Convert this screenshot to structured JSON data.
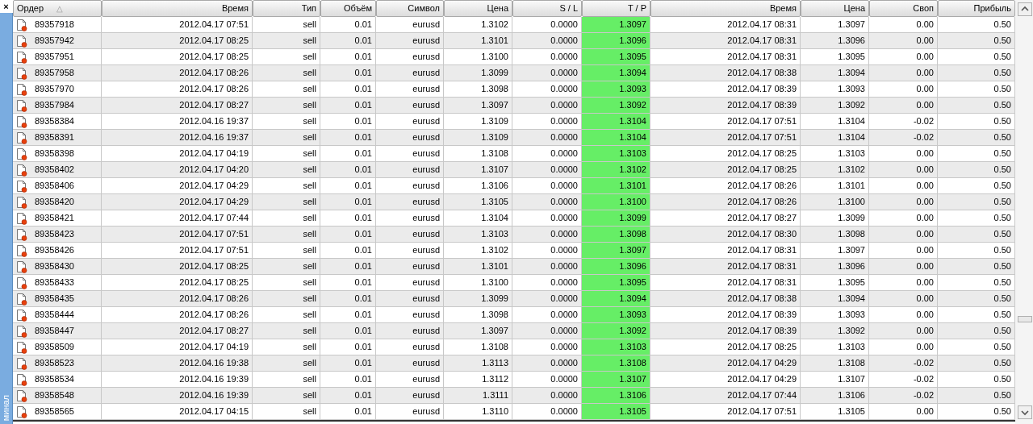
{
  "side_panel": {
    "close": "×",
    "label": "минал"
  },
  "table": {
    "columns": [
      {
        "label": "Ордер",
        "sort_indicator": "△",
        "highlight": false
      },
      {
        "label": "Время",
        "highlight": false
      },
      {
        "label": "Тип",
        "highlight": false
      },
      {
        "label": "Объём",
        "highlight": false
      },
      {
        "label": "Символ",
        "highlight": false
      },
      {
        "label": "Цена",
        "highlight": false
      },
      {
        "label": "S / L",
        "highlight": false
      },
      {
        "label": "T / P",
        "highlight": true
      },
      {
        "label": "Время",
        "highlight": false
      },
      {
        "label": "Цена",
        "highlight": false
      },
      {
        "label": "Своп",
        "highlight": false
      },
      {
        "label": "Прибыль",
        "highlight": false
      }
    ],
    "rows": [
      [
        "89357918",
        "2012.04.17 07:51",
        "sell",
        "0.01",
        "eurusd",
        "1.3102",
        "0.0000",
        "1.3097",
        "2012.04.17 08:31",
        "1.3097",
        "0.00",
        "0.50"
      ],
      [
        "89357942",
        "2012.04.17 08:25",
        "sell",
        "0.01",
        "eurusd",
        "1.3101",
        "0.0000",
        "1.3096",
        "2012.04.17 08:31",
        "1.3096",
        "0.00",
        "0.50"
      ],
      [
        "89357951",
        "2012.04.17 08:25",
        "sell",
        "0.01",
        "eurusd",
        "1.3100",
        "0.0000",
        "1.3095",
        "2012.04.17 08:31",
        "1.3095",
        "0.00",
        "0.50"
      ],
      [
        "89357958",
        "2012.04.17 08:26",
        "sell",
        "0.01",
        "eurusd",
        "1.3099",
        "0.0000",
        "1.3094",
        "2012.04.17 08:38",
        "1.3094",
        "0.00",
        "0.50"
      ],
      [
        "89357970",
        "2012.04.17 08:26",
        "sell",
        "0.01",
        "eurusd",
        "1.3098",
        "0.0000",
        "1.3093",
        "2012.04.17 08:39",
        "1.3093",
        "0.00",
        "0.50"
      ],
      [
        "89357984",
        "2012.04.17 08:27",
        "sell",
        "0.01",
        "eurusd",
        "1.3097",
        "0.0000",
        "1.3092",
        "2012.04.17 08:39",
        "1.3092",
        "0.00",
        "0.50"
      ],
      [
        "89358384",
        "2012.04.16 19:37",
        "sell",
        "0.01",
        "eurusd",
        "1.3109",
        "0.0000",
        "1.3104",
        "2012.04.17 07:51",
        "1.3104",
        "-0.02",
        "0.50"
      ],
      [
        "89358391",
        "2012.04.16 19:37",
        "sell",
        "0.01",
        "eurusd",
        "1.3109",
        "0.0000",
        "1.3104",
        "2012.04.17 07:51",
        "1.3104",
        "-0.02",
        "0.50"
      ],
      [
        "89358398",
        "2012.04.17 04:19",
        "sell",
        "0.01",
        "eurusd",
        "1.3108",
        "0.0000",
        "1.3103",
        "2012.04.17 08:25",
        "1.3103",
        "0.00",
        "0.50"
      ],
      [
        "89358402",
        "2012.04.17 04:20",
        "sell",
        "0.01",
        "eurusd",
        "1.3107",
        "0.0000",
        "1.3102",
        "2012.04.17 08:25",
        "1.3102",
        "0.00",
        "0.50"
      ],
      [
        "89358406",
        "2012.04.17 04:29",
        "sell",
        "0.01",
        "eurusd",
        "1.3106",
        "0.0000",
        "1.3101",
        "2012.04.17 08:26",
        "1.3101",
        "0.00",
        "0.50"
      ],
      [
        "89358420",
        "2012.04.17 04:29",
        "sell",
        "0.01",
        "eurusd",
        "1.3105",
        "0.0000",
        "1.3100",
        "2012.04.17 08:26",
        "1.3100",
        "0.00",
        "0.50"
      ],
      [
        "89358421",
        "2012.04.17 07:44",
        "sell",
        "0.01",
        "eurusd",
        "1.3104",
        "0.0000",
        "1.3099",
        "2012.04.17 08:27",
        "1.3099",
        "0.00",
        "0.50"
      ],
      [
        "89358423",
        "2012.04.17 07:51",
        "sell",
        "0.01",
        "eurusd",
        "1.3103",
        "0.0000",
        "1.3098",
        "2012.04.17 08:30",
        "1.3098",
        "0.00",
        "0.50"
      ],
      [
        "89358426",
        "2012.04.17 07:51",
        "sell",
        "0.01",
        "eurusd",
        "1.3102",
        "0.0000",
        "1.3097",
        "2012.04.17 08:31",
        "1.3097",
        "0.00",
        "0.50"
      ],
      [
        "89358430",
        "2012.04.17 08:25",
        "sell",
        "0.01",
        "eurusd",
        "1.3101",
        "0.0000",
        "1.3096",
        "2012.04.17 08:31",
        "1.3096",
        "0.00",
        "0.50"
      ],
      [
        "89358433",
        "2012.04.17 08:25",
        "sell",
        "0.01",
        "eurusd",
        "1.3100",
        "0.0000",
        "1.3095",
        "2012.04.17 08:31",
        "1.3095",
        "0.00",
        "0.50"
      ],
      [
        "89358435",
        "2012.04.17 08:26",
        "sell",
        "0.01",
        "eurusd",
        "1.3099",
        "0.0000",
        "1.3094",
        "2012.04.17 08:38",
        "1.3094",
        "0.00",
        "0.50"
      ],
      [
        "89358444",
        "2012.04.17 08:26",
        "sell",
        "0.01",
        "eurusd",
        "1.3098",
        "0.0000",
        "1.3093",
        "2012.04.17 08:39",
        "1.3093",
        "0.00",
        "0.50"
      ],
      [
        "89358447",
        "2012.04.17 08:27",
        "sell",
        "0.01",
        "eurusd",
        "1.3097",
        "0.0000",
        "1.3092",
        "2012.04.17 08:39",
        "1.3092",
        "0.00",
        "0.50"
      ],
      [
        "89358509",
        "2012.04.17 04:19",
        "sell",
        "0.01",
        "eurusd",
        "1.3108",
        "0.0000",
        "1.3103",
        "2012.04.17 08:25",
        "1.3103",
        "0.00",
        "0.50"
      ],
      [
        "89358523",
        "2012.04.16 19:38",
        "sell",
        "0.01",
        "eurusd",
        "1.3113",
        "0.0000",
        "1.3108",
        "2012.04.17 04:29",
        "1.3108",
        "-0.02",
        "0.50"
      ],
      [
        "89358534",
        "2012.04.16 19:39",
        "sell",
        "0.01",
        "eurusd",
        "1.3112",
        "0.0000",
        "1.3107",
        "2012.04.17 04:29",
        "1.3107",
        "-0.02",
        "0.50"
      ],
      [
        "89358548",
        "2012.04.16 19:39",
        "sell",
        "0.01",
        "eurusd",
        "1.3111",
        "0.0000",
        "1.3106",
        "2012.04.17 07:44",
        "1.3106",
        "-0.02",
        "0.50"
      ],
      [
        "89358565",
        "2012.04.17 04:15",
        "sell",
        "0.01",
        "eurusd",
        "1.3110",
        "0.0000",
        "1.3105",
        "2012.04.17 07:51",
        "1.3105",
        "0.00",
        "0.50"
      ]
    ]
  }
}
